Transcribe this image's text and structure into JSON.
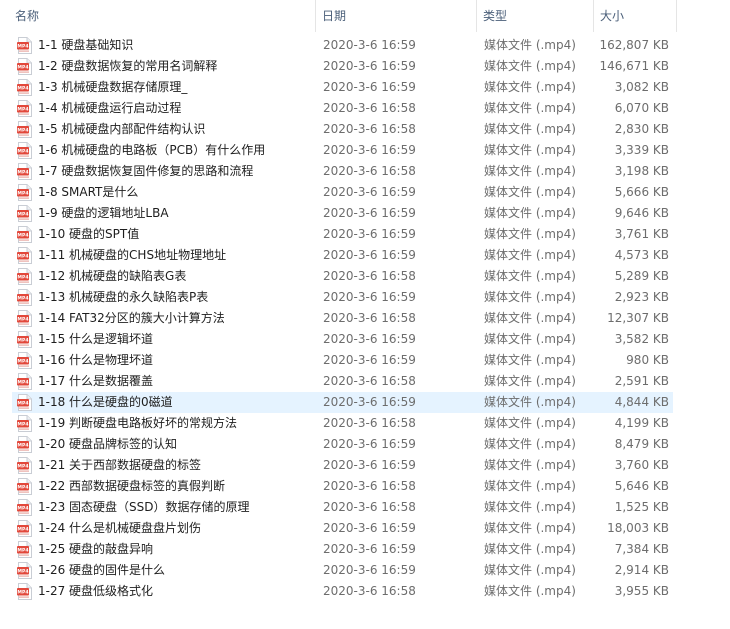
{
  "columns": {
    "name": "名称",
    "date": "日期",
    "type": "类型",
    "size": "大小"
  },
  "icon": "mp4-file-icon",
  "accent_selected": "#e5f3ff",
  "files": [
    {
      "name": "1-1 硬盘基础知识",
      "date": "2020-3-6 16:59",
      "type": "媒体文件 (.mp4)",
      "size": "162,807 KB"
    },
    {
      "name": "1-2 硬盘数据恢复的常用名词解释",
      "date": "2020-3-6 16:59",
      "type": "媒体文件 (.mp4)",
      "size": "146,671 KB"
    },
    {
      "name": "1-3 机械硬盘数据存储原理_",
      "date": "2020-3-6 16:59",
      "type": "媒体文件 (.mp4)",
      "size": "3,082 KB"
    },
    {
      "name": "1-4 机械硬盘运行启动过程",
      "date": "2020-3-6 16:58",
      "type": "媒体文件 (.mp4)",
      "size": "6,070 KB"
    },
    {
      "name": "1-5 机械硬盘内部配件结构认识",
      "date": "2020-3-6 16:58",
      "type": "媒体文件 (.mp4)",
      "size": "2,830 KB"
    },
    {
      "name": "1-6 机械硬盘的电路板（PCB）有什么作用",
      "date": "2020-3-6 16:59",
      "type": "媒体文件 (.mp4)",
      "size": "3,339 KB"
    },
    {
      "name": "1-7 硬盘数据恢复固件修复的思路和流程",
      "date": "2020-3-6 16:58",
      "type": "媒体文件 (.mp4)",
      "size": "3,198 KB"
    },
    {
      "name": "1-8 SMART是什么",
      "date": "2020-3-6 16:59",
      "type": "媒体文件 (.mp4)",
      "size": "5,666 KB"
    },
    {
      "name": "1-9 硬盘的逻辑地址LBA",
      "date": "2020-3-6 16:59",
      "type": "媒体文件 (.mp4)",
      "size": "9,646 KB"
    },
    {
      "name": "1-10 硬盘的SPT值",
      "date": "2020-3-6 16:59",
      "type": "媒体文件 (.mp4)",
      "size": "3,761 KB"
    },
    {
      "name": "1-11 机械硬盘的CHS地址物理地址",
      "date": "2020-3-6 16:59",
      "type": "媒体文件 (.mp4)",
      "size": "4,573 KB"
    },
    {
      "name": "1-12 机械硬盘的缺陷表G表",
      "date": "2020-3-6 16:58",
      "type": "媒体文件 (.mp4)",
      "size": "5,289 KB"
    },
    {
      "name": "1-13 机械硬盘的永久缺陷表P表",
      "date": "2020-3-6 16:59",
      "type": "媒体文件 (.mp4)",
      "size": "2,923 KB"
    },
    {
      "name": "1-14 FAT32分区的簇大小计算方法",
      "date": "2020-3-6 16:58",
      "type": "媒体文件 (.mp4)",
      "size": "12,307 KB"
    },
    {
      "name": "1-15 什么是逻辑坏道",
      "date": "2020-3-6 16:59",
      "type": "媒体文件 (.mp4)",
      "size": "3,582 KB"
    },
    {
      "name": "1-16 什么是物理坏道",
      "date": "2020-3-6 16:59",
      "type": "媒体文件 (.mp4)",
      "size": "980 KB"
    },
    {
      "name": "1-17 什么是数据覆盖",
      "date": "2020-3-6 16:58",
      "type": "媒体文件 (.mp4)",
      "size": "2,591 KB"
    },
    {
      "name": "1-18 什么是硬盘的0磁道",
      "date": "2020-3-6 16:59",
      "type": "媒体文件 (.mp4)",
      "size": "4,844 KB",
      "selected": true
    },
    {
      "name": "1-19 判断硬盘电路板好坏的常规方法",
      "date": "2020-3-6 16:58",
      "type": "媒体文件 (.mp4)",
      "size": "4,199 KB"
    },
    {
      "name": "1-20 硬盘品牌标签的认知",
      "date": "2020-3-6 16:59",
      "type": "媒体文件 (.mp4)",
      "size": "8,479 KB"
    },
    {
      "name": "1-21 关于西部数据硬盘的标签",
      "date": "2020-3-6 16:59",
      "type": "媒体文件 (.mp4)",
      "size": "3,760 KB"
    },
    {
      "name": "1-22 西部数据硬盘标签的真假判断",
      "date": "2020-3-6 16:58",
      "type": "媒体文件 (.mp4)",
      "size": "5,646 KB"
    },
    {
      "name": "1-23 固态硬盘（SSD）数据存储的原理",
      "date": "2020-3-6 16:58",
      "type": "媒体文件 (.mp4)",
      "size": "1,525 KB"
    },
    {
      "name": "1-24 什么是机械硬盘盘片划伤",
      "date": "2020-3-6 16:59",
      "type": "媒体文件 (.mp4)",
      "size": "18,003 KB"
    },
    {
      "name": "1-25 硬盘的敲盘异响",
      "date": "2020-3-6 16:59",
      "type": "媒体文件 (.mp4)",
      "size": "7,384 KB"
    },
    {
      "name": "1-26 硬盘的固件是什么",
      "date": "2020-3-6 16:59",
      "type": "媒体文件 (.mp4)",
      "size": "2,914 KB"
    },
    {
      "name": "1-27 硬盘低级格式化",
      "date": "2020-3-6 16:58",
      "type": "媒体文件 (.mp4)",
      "size": "3,955 KB"
    }
  ]
}
